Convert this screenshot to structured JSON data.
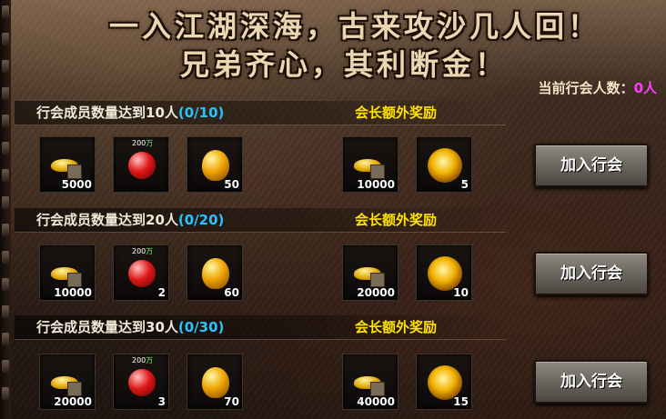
{
  "header": {
    "slogan_line1": "一入江湖深海，古来攻沙几人回！",
    "slogan_line2": "兄弟齐心，其利断金！",
    "member_count_label": "当前行会人数：",
    "member_count_value": "0人"
  },
  "tiers": [
    {
      "title": "行会成员数量达到10人",
      "progress": "(0/10)",
      "leader_label": "会长额外奖励",
      "rewards": [
        {
          "icon": "gold-ingot-icon",
          "qty": "5000"
        },
        {
          "icon": "red-apple-icon",
          "qty": "",
          "tag_num": "200",
          "tag_unit": "万"
        },
        {
          "icon": "golden-fruit-icon",
          "qty": "50"
        }
      ],
      "leader_rewards": [
        {
          "icon": "gold-ingot-icon",
          "qty": "10000"
        },
        {
          "icon": "golden-orb-icon",
          "qty": "5"
        }
      ],
      "join_label": "加入行会"
    },
    {
      "title": "行会成员数量达到20人",
      "progress": "(0/20)",
      "leader_label": "会长额外奖励",
      "rewards": [
        {
          "icon": "gold-ingot-icon",
          "qty": "10000"
        },
        {
          "icon": "red-apple-icon",
          "qty": "2",
          "tag_num": "200",
          "tag_unit": "万"
        },
        {
          "icon": "golden-fruit-icon",
          "qty": "60"
        }
      ],
      "leader_rewards": [
        {
          "icon": "gold-ingot-icon",
          "qty": "20000"
        },
        {
          "icon": "golden-orb-icon",
          "qty": "10"
        }
      ],
      "join_label": "加入行会"
    },
    {
      "title": "行会成员数量达到30人",
      "progress": "(0/30)",
      "leader_label": "会长额外奖励",
      "rewards": [
        {
          "icon": "gold-ingot-icon",
          "qty": "20000"
        },
        {
          "icon": "red-apple-icon",
          "qty": "3",
          "tag_num": "200",
          "tag_unit": "万"
        },
        {
          "icon": "golden-fruit-icon",
          "qty": "70"
        }
      ],
      "leader_rewards": [
        {
          "icon": "gold-ingot-icon",
          "qty": "40000"
        },
        {
          "icon": "golden-orb-icon",
          "qty": "15"
        }
      ],
      "join_label": "加入行会"
    }
  ],
  "colors": {
    "progress": "#27c5ff",
    "leader_label": "#ffe300",
    "member_count": "#ff3cff"
  }
}
